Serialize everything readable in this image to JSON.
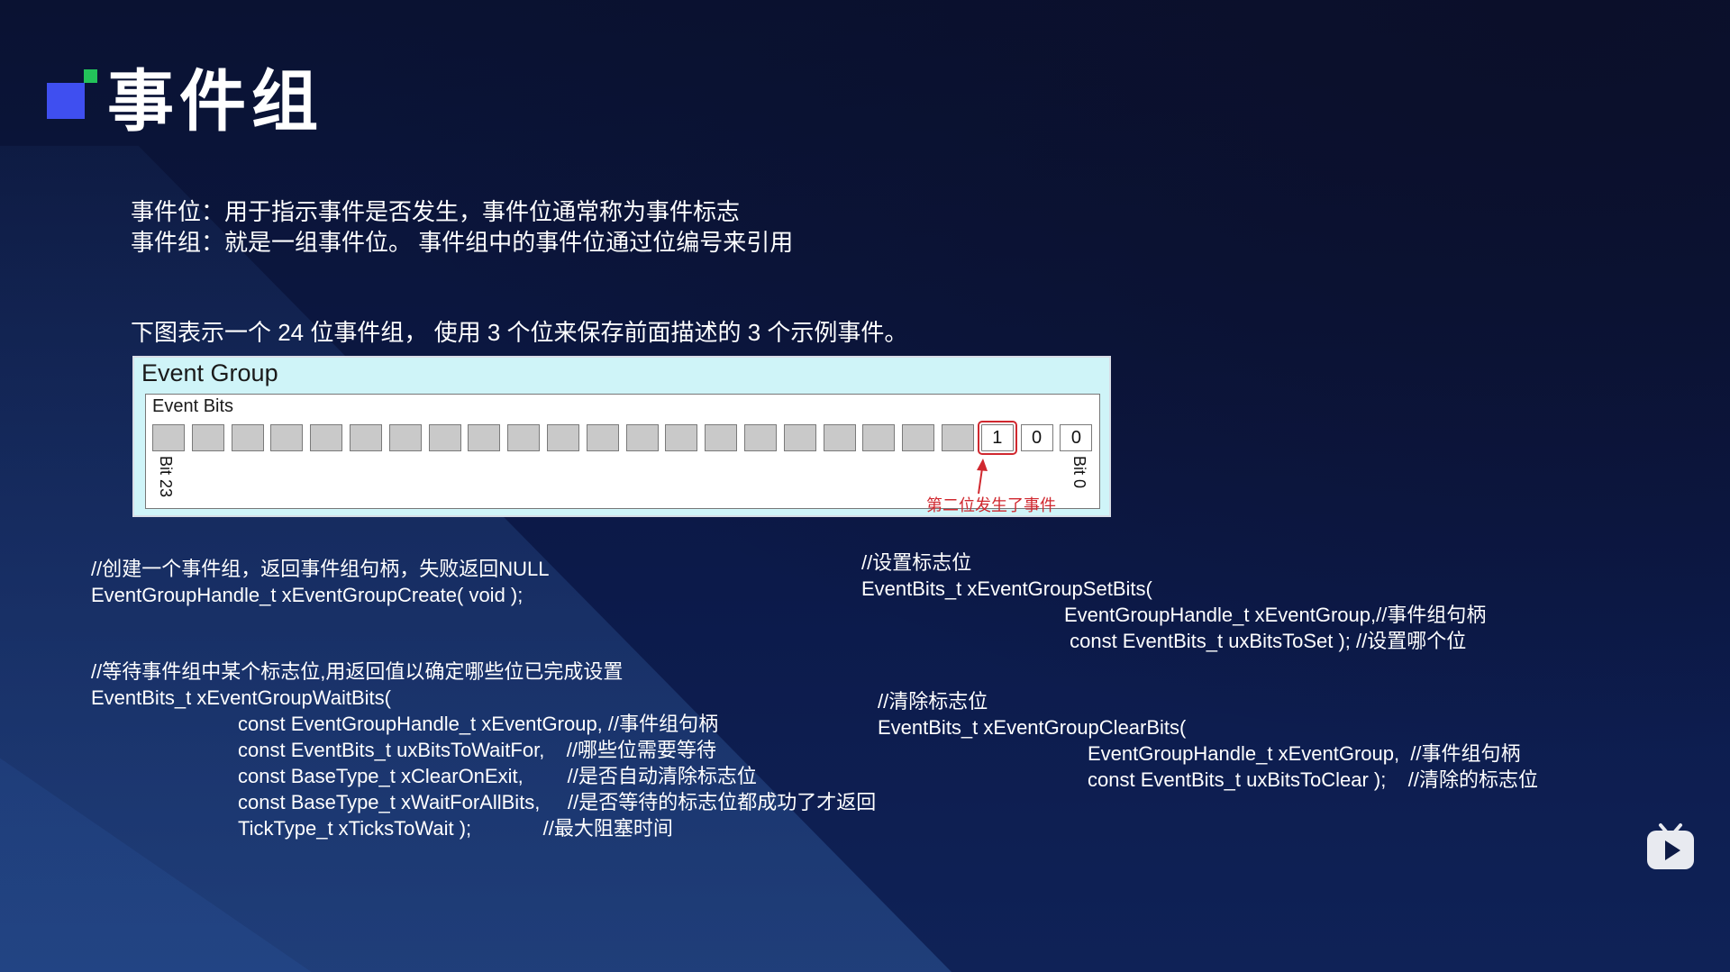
{
  "slide": {
    "title": "事件组",
    "desc_line1": "事件位：用于指示事件是否发生，事件位通常称为事件标志",
    "desc_line2": "事件组：就是一组事件位。 事件组中的事件位通过位编号来引用",
    "diagram_caption": "下图表示一个 24 位事件组， 使用 3 个位来保存前面描述的 3 个示例事件。"
  },
  "diagram": {
    "group_label": "Event Group",
    "bits_label": "Event Bits",
    "bit_values": [
      "",
      "",
      "",
      "",
      "",
      "",
      "",
      "",
      "",
      "",
      "",
      "",
      "",
      "",
      "",
      "",
      "",
      "",
      "",
      "",
      "",
      "1",
      "0",
      "0"
    ],
    "highlighted_index": 21,
    "left_bit_label": "Bit 23",
    "right_bit_label": "Bit 0",
    "annotation": "第二位发生了事件",
    "colors": {
      "annotation": "#d0282f",
      "group_bg": "#cff4f8",
      "inactive_bit": "#c9c9c9"
    }
  },
  "code": {
    "create_comment": "//创建一个事件组，返回事件组句柄，失败返回NULL",
    "create_decl": "EventGroupHandle_t xEventGroupCreate( void );",
    "wait_comment": "//等待事件组中某个标志位,用返回值以确定哪些位已完成设置",
    "wait_decl": "EventBits_t xEventGroupWaitBits(",
    "wait_param1": "const EventGroupHandle_t xEventGroup, //事件组句柄",
    "wait_param2": "const EventBits_t uxBitsToWaitFor,    //哪些位需要等待",
    "wait_param3": "const BaseType_t xClearOnExit,        //是否自动清除标志位",
    "wait_param4": "const BaseType_t xWaitForAllBits,     //是否等待的标志位都成功了才返回",
    "wait_param5": "TickType_t xTicksToWait );             //最大阻塞时间",
    "set_comment": "//设置标志位",
    "set_decl": "EventBits_t xEventGroupSetBits(",
    "set_param1": "EventGroupHandle_t xEventGroup,//事件组句柄",
    "set_param2": " const EventBits_t uxBitsToSet ); //设置哪个位",
    "clear_comment": "//清除标志位",
    "clear_decl": "EventBits_t xEventGroupClearBits(",
    "clear_param1": "EventGroupHandle_t xEventGroup,  //事件组句柄",
    "clear_param2": "const EventBits_t uxBitsToClear );    //清除的标志位"
  },
  "watermark": {
    "icon": "bilibili-tv-icon"
  },
  "theme": {
    "logo_blue": "#3f4ff0",
    "logo_green": "#23c25a",
    "background": "#0b1640"
  }
}
